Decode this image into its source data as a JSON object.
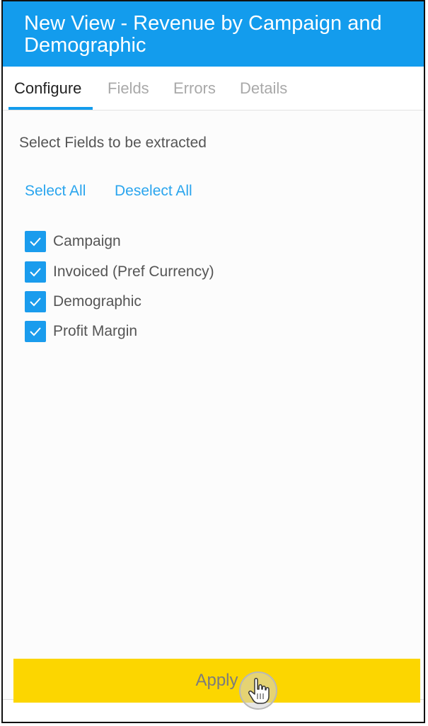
{
  "header": {
    "title": "New View - Revenue by Campaign and Demographic"
  },
  "tabs": [
    {
      "label": "Configure",
      "active": true
    },
    {
      "label": "Fields",
      "active": false
    },
    {
      "label": "Errors",
      "active": false
    },
    {
      "label": "Details",
      "active": false
    }
  ],
  "main": {
    "section_title": "Select Fields to be extracted",
    "select_all_label": "Select All",
    "deselect_all_label": "Deselect All",
    "fields": [
      {
        "label": "Campaign",
        "checked": true
      },
      {
        "label": "Invoiced (Pref Currency)",
        "checked": true
      },
      {
        "label": "Demographic",
        "checked": true
      },
      {
        "label": "Profit Margin",
        "checked": true
      }
    ]
  },
  "footer": {
    "apply_label": "Apply"
  },
  "colors": {
    "accent": "#139ced",
    "apply_button": "#fcd600",
    "link": "#2aa5ee"
  },
  "icons": {
    "checkbox": "checkmark-icon",
    "cursor": "hand-pointer-icon"
  }
}
